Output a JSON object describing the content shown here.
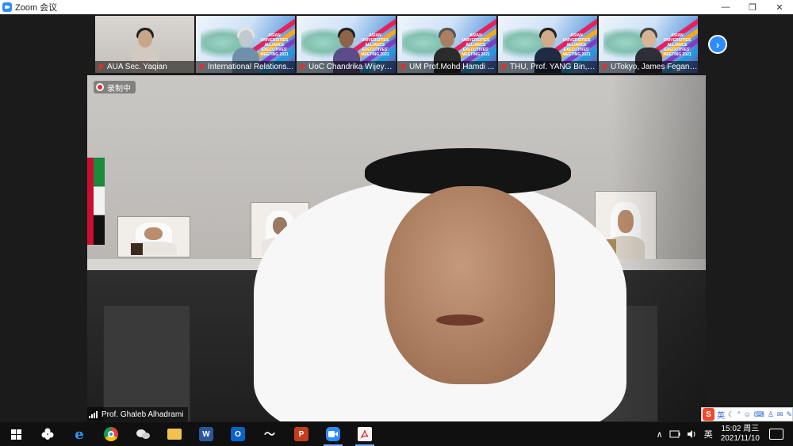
{
  "window": {
    "title": "Zoom 会议",
    "controls": {
      "minimize": "—",
      "restore": "❐",
      "close": "✕"
    }
  },
  "thumbnails": [
    {
      "name": "AUA Sec. Yaqian",
      "muted": true,
      "bg": "photo"
    },
    {
      "name": "International Relations...",
      "muted": true,
      "bg": "banner"
    },
    {
      "name": "UoC Chandrika Wijeyar...",
      "muted": true,
      "bg": "banner"
    },
    {
      "name": "UM Prof.Mohd Hamdi ...",
      "muted": true,
      "bg": "banner"
    },
    {
      "name": "THU, Prof. YANG Bin, V...",
      "muted": true,
      "bg": "banner"
    },
    {
      "name": "UTokyo, James Fegan, ...",
      "muted": true,
      "bg": "banner"
    }
  ],
  "banner_text": "ASIAN UNIVERSITIES ALLIANCE EXECUTIVES' MEETING 2021",
  "next_button": "›",
  "recording": {
    "label": "录制中"
  },
  "speaker": {
    "name": "Prof. Ghaleb Alhadrami"
  },
  "ime": {
    "logo": "S",
    "lang": "英",
    "tools": [
      "☾",
      "°",
      "☺",
      "⌨",
      "♙",
      "✉",
      "✎"
    ]
  },
  "taskbar": {
    "apps": [
      "start",
      "search-shell",
      "ie",
      "chrome",
      "wechat",
      "explorer",
      "word",
      "outlook",
      "app-wave",
      "powerpoint",
      "zoom",
      "acrobat"
    ],
    "labels": {
      "word": "W",
      "outlook": "O",
      "powerpoint": "P",
      "ie": "e",
      "wave": "〜"
    },
    "tray": {
      "chevron": "∧",
      "lang": "英",
      "time": "15:02 周三",
      "date": "2021/11/10"
    }
  },
  "colors": {
    "zoom_blue": "#2D8CFF",
    "mute_red": "#E02E2E"
  }
}
